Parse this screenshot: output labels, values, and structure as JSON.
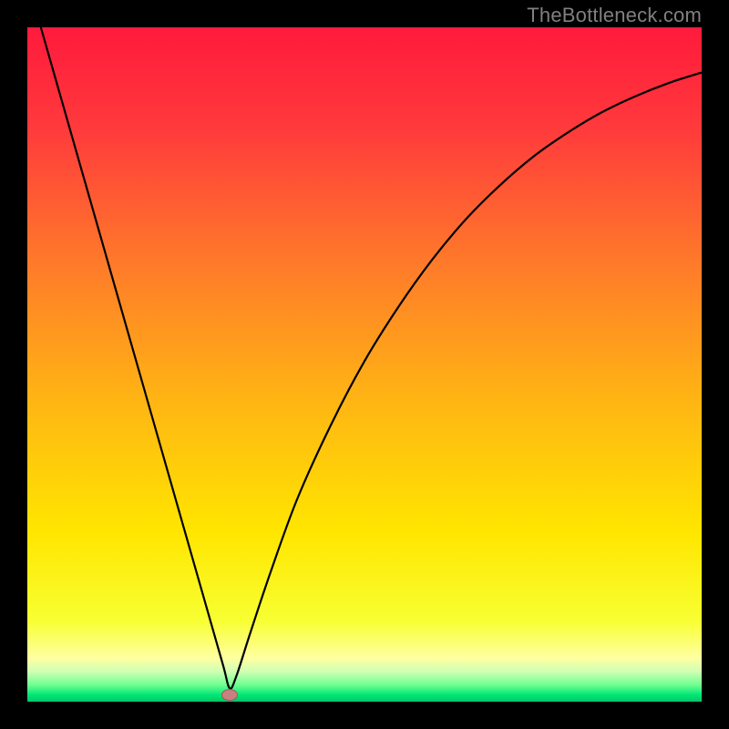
{
  "watermark": "TheBottleneck.com",
  "colors": {
    "frame": "#000000",
    "curve": "#000000",
    "marker_fill": "#c98080",
    "marker_stroke": "#a05858",
    "gradient_stops": [
      {
        "offset": 0.0,
        "color": "#ff1a3c"
      },
      {
        "offset": 0.15,
        "color": "#ff3a3c"
      },
      {
        "offset": 0.35,
        "color": "#ff7a2a"
      },
      {
        "offset": 0.55,
        "color": "#ffb414"
      },
      {
        "offset": 0.75,
        "color": "#ffe600"
      },
      {
        "offset": 0.88,
        "color": "#f8ff32"
      },
      {
        "offset": 0.935,
        "color": "#ffffa0"
      },
      {
        "offset": 0.955,
        "color": "#d0ffb4"
      },
      {
        "offset": 0.975,
        "color": "#70ff91"
      },
      {
        "offset": 0.99,
        "color": "#00e676"
      },
      {
        "offset": 1.0,
        "color": "#00c864"
      }
    ]
  },
  "chart_data": {
    "type": "line",
    "title": "",
    "xlabel": "",
    "ylabel": "",
    "xlim": [
      0,
      1
    ],
    "ylim": [
      0,
      1
    ],
    "x": [
      0.02,
      0.05,
      0.08,
      0.11,
      0.14,
      0.17,
      0.2,
      0.23,
      0.26,
      0.29,
      0.3,
      0.31,
      0.33,
      0.36,
      0.4,
      0.45,
      0.5,
      0.55,
      0.6,
      0.65,
      0.7,
      0.75,
      0.8,
      0.85,
      0.9,
      0.95,
      1.0
    ],
    "values": [
      1.0,
      0.895,
      0.79,
      0.685,
      0.58,
      0.475,
      0.37,
      0.265,
      0.16,
      0.055,
      0.02,
      0.038,
      0.1,
      0.19,
      0.3,
      0.41,
      0.505,
      0.585,
      0.655,
      0.715,
      0.765,
      0.808,
      0.843,
      0.873,
      0.897,
      0.917,
      0.933
    ],
    "min_point": {
      "x": 0.3,
      "y": 0.01
    },
    "annotations": []
  }
}
